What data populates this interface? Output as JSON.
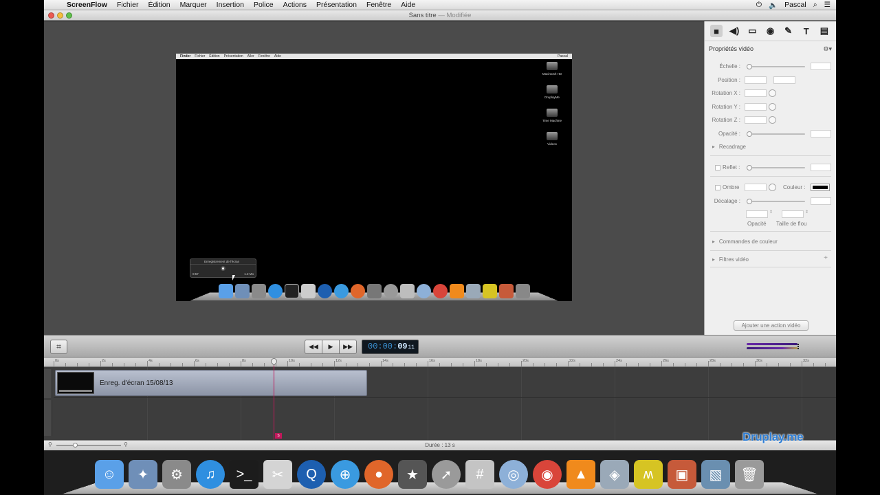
{
  "menubar": {
    "app": "ScreenFlow",
    "items": [
      "Fichier",
      "Édition",
      "Marquer",
      "Insertion",
      "Police",
      "Actions",
      "Présentation",
      "Fenêtre",
      "Aide"
    ],
    "user": "Pascal"
  },
  "window": {
    "title": "Sans titre",
    "modified": "— Modifiée"
  },
  "preview": {
    "menu": [
      "Finder",
      "Fichier",
      "Édition",
      "Présentation",
      "Aller",
      "Fenêtre",
      "Aide"
    ],
    "user": "Pascal",
    "desktop_items": [
      "Macintosh HD",
      "DruplayMe",
      "Time Machine",
      "Videos"
    ],
    "recorder": {
      "title": "Enregistrement de l'écran",
      "time": "0:57",
      "size": "1.2 Mo"
    }
  },
  "inspector": {
    "title": "Propriétés vidéo",
    "labels": {
      "scale": "Échelle :",
      "position": "Position :",
      "rotx": "Rotation X :",
      "roty": "Rotation Y :",
      "rotz": "Rotation Z :",
      "opacity": "Opacité :",
      "crop": "Recadrage",
      "reflection": "Reflet :",
      "shadow": "Ombre",
      "color": "Couleur :",
      "offset": "Décalage :",
      "shadow_opacity": "Opacité",
      "blur": "Taille de flou",
      "color_controls": "Commandes de couleur",
      "video_filters": "Filtres vidéo",
      "add_action": "Ajouter une action vidéo"
    },
    "shadow_color": "#000000"
  },
  "transport": {
    "timecode_prefix": "00:00:",
    "timecode_sec": "09",
    "timecode_frames": "11"
  },
  "ruler": {
    "labels": [
      "0s",
      "2s",
      "4s",
      "6s",
      "8s",
      "10s",
      "12s",
      "14s",
      "16s",
      "18s",
      "20s",
      "22s",
      "24s",
      "26s",
      "28s",
      "30s",
      "32s"
    ]
  },
  "timeline": {
    "clip_label": "Enreg. d'écran 15/08/13",
    "playhead_marker": "S"
  },
  "status": {
    "duration": "Durée : 13 s"
  },
  "watermark": "Druplay.me",
  "colors": {
    "accent_playhead": "#c2185b",
    "timecode": "#3a8fd0"
  },
  "dock_icons": [
    "finder-icon",
    "preview-icon",
    "system-preferences-icon",
    "itunes-icon",
    "terminal-icon",
    "scissors-icon",
    "quicktime-icon",
    "safari-icon",
    "firefox-icon",
    "imovie-icon",
    "launchpad-icon",
    "calculator-icon",
    "network-icon",
    "chrome-icon",
    "vlc-icon",
    "preview-app-icon",
    "druplay-icon",
    "keynote-icon",
    "iphoto-icon",
    "trash-icon"
  ]
}
